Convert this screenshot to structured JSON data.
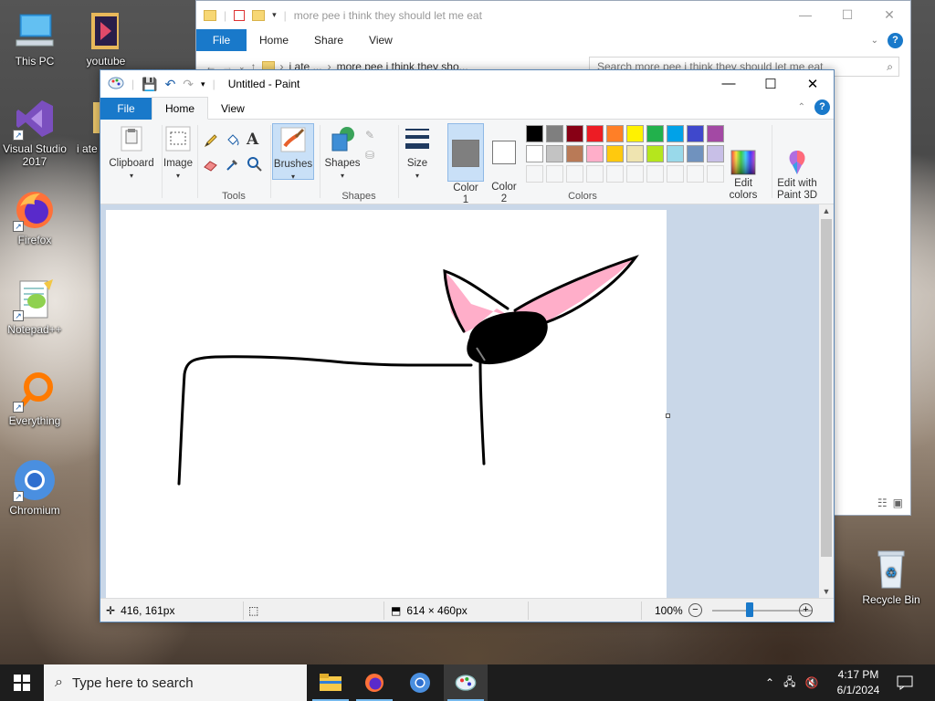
{
  "desktop": {
    "icons": [
      {
        "label": "This PC"
      },
      {
        "label": "youtube"
      },
      {
        "label": "Visual Studio 2017"
      },
      {
        "label": "i ate"
      },
      {
        "label": "Firefox"
      },
      {
        "label": "Notepad++"
      },
      {
        "label": "Everything"
      },
      {
        "label": "Chromium"
      },
      {
        "label": "Recycle Bin"
      }
    ]
  },
  "explorer": {
    "title": "more pee i think they should let me eat",
    "tabs": {
      "file": "File",
      "home": "Home",
      "share": "Share",
      "view": "View"
    },
    "breadcrumb": [
      "i ate ...",
      "more pee i think they sho..."
    ],
    "search_placeholder": "Search more pee i think they should let me eat"
  },
  "paint": {
    "title": "Untitled - Paint",
    "tabs": {
      "file": "File",
      "home": "Home",
      "view": "View"
    },
    "ribbon": {
      "clipboard": "Clipboard",
      "image": "Image",
      "tools": "Tools",
      "brushes": "Brushes",
      "shapes_btn": "Shapes",
      "shapes_group": "Shapes",
      "size": "Size",
      "color1": "Color\n1",
      "color2": "Color\n2",
      "colors_group": "Colors",
      "edit_colors": "Edit\ncolors",
      "edit_paint3d": "Edit with\nPaint 3D"
    },
    "palette_row1": [
      "#000000",
      "#7f7f7f",
      "#880015",
      "#ed1c24",
      "#ff7f27",
      "#fff200",
      "#22b14c",
      "#00a2e8",
      "#3f48cc",
      "#a349a4"
    ],
    "palette_row2": [
      "#ffffff",
      "#c3c3c3",
      "#b97a57",
      "#ffaec9",
      "#ffc90e",
      "#efe4b0",
      "#b5e61d",
      "#99d9ea",
      "#7092be",
      "#c8bfe7"
    ],
    "color1_value": "#7f7f7f",
    "color2_value": "#ffffff",
    "status": {
      "cursor_pos": "416, 161px",
      "canvas_size": "614 × 460px",
      "zoom": "100%"
    }
  },
  "taskbar": {
    "search_placeholder": "Type here to search",
    "time": "4:17 PM",
    "date": "6/1/2024"
  }
}
